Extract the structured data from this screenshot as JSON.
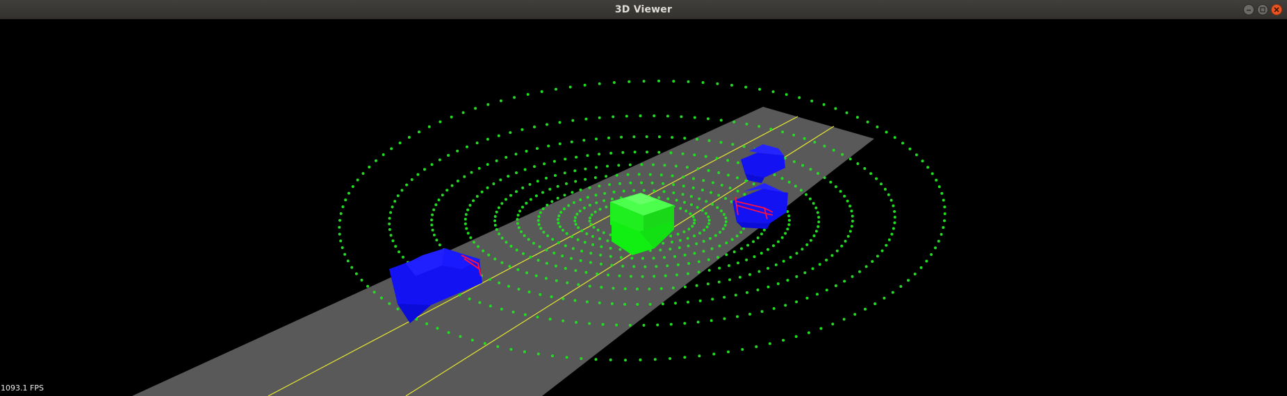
{
  "window": {
    "title": "3D Viewer",
    "buttons": {
      "minimize": "minimize-icon",
      "maximize": "maximize-icon",
      "close": "close-icon"
    }
  },
  "viewport": {
    "background": "#000000",
    "road_color": "#595959",
    "lane_line_color": "#e8e832",
    "point_cloud_color": "#22dd22",
    "ego_vehicle_color": "#11ee11",
    "other_vehicle_color": "#1010f0",
    "highlight_color": "#ff1040"
  },
  "status": {
    "fps_text": "1093.1 FPS"
  }
}
